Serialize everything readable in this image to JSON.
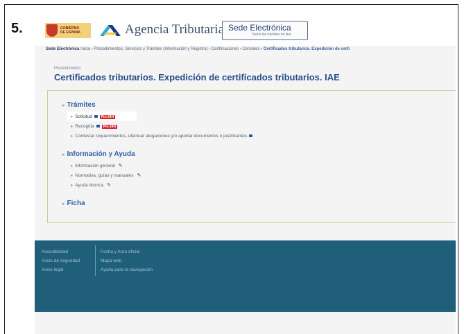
{
  "step_label": "5.",
  "header": {
    "gov_logo_text": [
      "GOBIERNO",
      "DE ESPAÑA"
    ],
    "agency_name": "Agencia Tributaria",
    "sede_title": "Sede Electrónica",
    "sede_subtitle": "Todos los trámites on line"
  },
  "breadcrumb": [
    "Sede Electrónica",
    "Inicio",
    "› Procedimientos, Servicios y Trámites (Información y Registro)",
    "› Certificaciones",
    "› Censales",
    "› Certificados tributarios. Expedición de certi"
  ],
  "page": {
    "kicker": "Procedimiento",
    "title": "Certificados tributarios. Expedición de certificados tributarios. IAE"
  },
  "sections": {
    "tramites": {
      "title": "Trámites",
      "items": [
        {
          "label": "Solicitud",
          "badge": "Pin 24H"
        },
        {
          "label": "Recogida",
          "badge": "Pin 24H"
        },
        {
          "label": "Contestar requerimientos, efectuar alegaciones y/o aportar documentos o justificantes"
        }
      ]
    },
    "info": {
      "title": "Información y Ayuda",
      "items": [
        {
          "label": "Información general"
        },
        {
          "label": "Normativa, guías y manuales"
        },
        {
          "label": "Ayuda técnica"
        }
      ]
    },
    "ficha": {
      "title": "Ficha"
    }
  },
  "footer": {
    "col1": [
      "Accesibilidad",
      "Aviso de seguridad",
      "Aviso legal"
    ],
    "col2": [
      "Fecha y hora oficial",
      "Mapa web",
      "Ayuda para la navegación"
    ]
  },
  "colors": {
    "accent": "#2f5ea4",
    "footer_bg": "#1f5f79",
    "badge": "#d8252f"
  }
}
